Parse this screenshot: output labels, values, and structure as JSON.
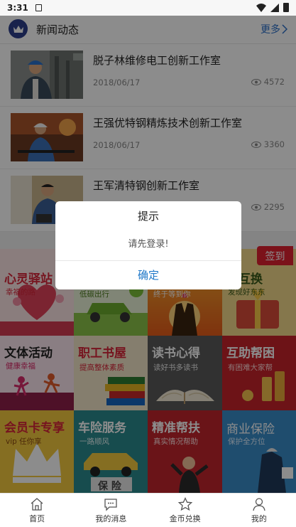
{
  "status_bar": {
    "time": "3:31"
  },
  "news": {
    "header_title": "新闻动态",
    "more_label": "更多",
    "items": [
      {
        "title": "脱子林维修电工创新工作室",
        "date": "2018/06/17",
        "views": "4572"
      },
      {
        "title": "王强优特钢精炼技术创新工作室",
        "date": "2018/06/17",
        "views": "3360"
      },
      {
        "title": "王军清特钢创新工作室",
        "date": "",
        "views": "2295"
      }
    ]
  },
  "sign_in_label": "签到",
  "tiles": [
    {
      "title": "心灵驿站",
      "subtitle": "幸福的路"
    },
    {
      "title": "",
      "subtitle": "低碳出行"
    },
    {
      "title": "",
      "subtitle": "终于等到你"
    },
    {
      "title": "心互换",
      "subtitle": "发现好东东"
    },
    {
      "title": "文体活动",
      "subtitle": "健康幸福"
    },
    {
      "title": "职工书屋",
      "subtitle": "提高整体素质"
    },
    {
      "title": "读书心得",
      "subtitle": "读好书多读书"
    },
    {
      "title": "互助帮困",
      "subtitle": "有困难大家帮"
    },
    {
      "title": "会员卡专享",
      "subtitle": "vip 任你享"
    },
    {
      "title": "车险服务",
      "subtitle": "一路顺风"
    },
    {
      "title": "精准帮扶",
      "subtitle": "真实情况帮助"
    },
    {
      "title": "商业保险",
      "subtitle": "保护全方位"
    }
  ],
  "tile_extra": {
    "insurance_sign": "保 险"
  },
  "tabbar": {
    "items": [
      {
        "label": "首页",
        "icon": "home-icon"
      },
      {
        "label": "我的消息",
        "icon": "message-icon"
      },
      {
        "label": "金币兑换",
        "icon": "star-icon"
      },
      {
        "label": "我的",
        "icon": "user-icon"
      }
    ]
  },
  "dialog": {
    "title": "提示",
    "message": "请先登录!",
    "confirm_label": "确定"
  },
  "colors": {
    "accent_blue": "#1f78c8",
    "sign_red": "#e02231",
    "logo_navy": "#2c3e8a"
  }
}
